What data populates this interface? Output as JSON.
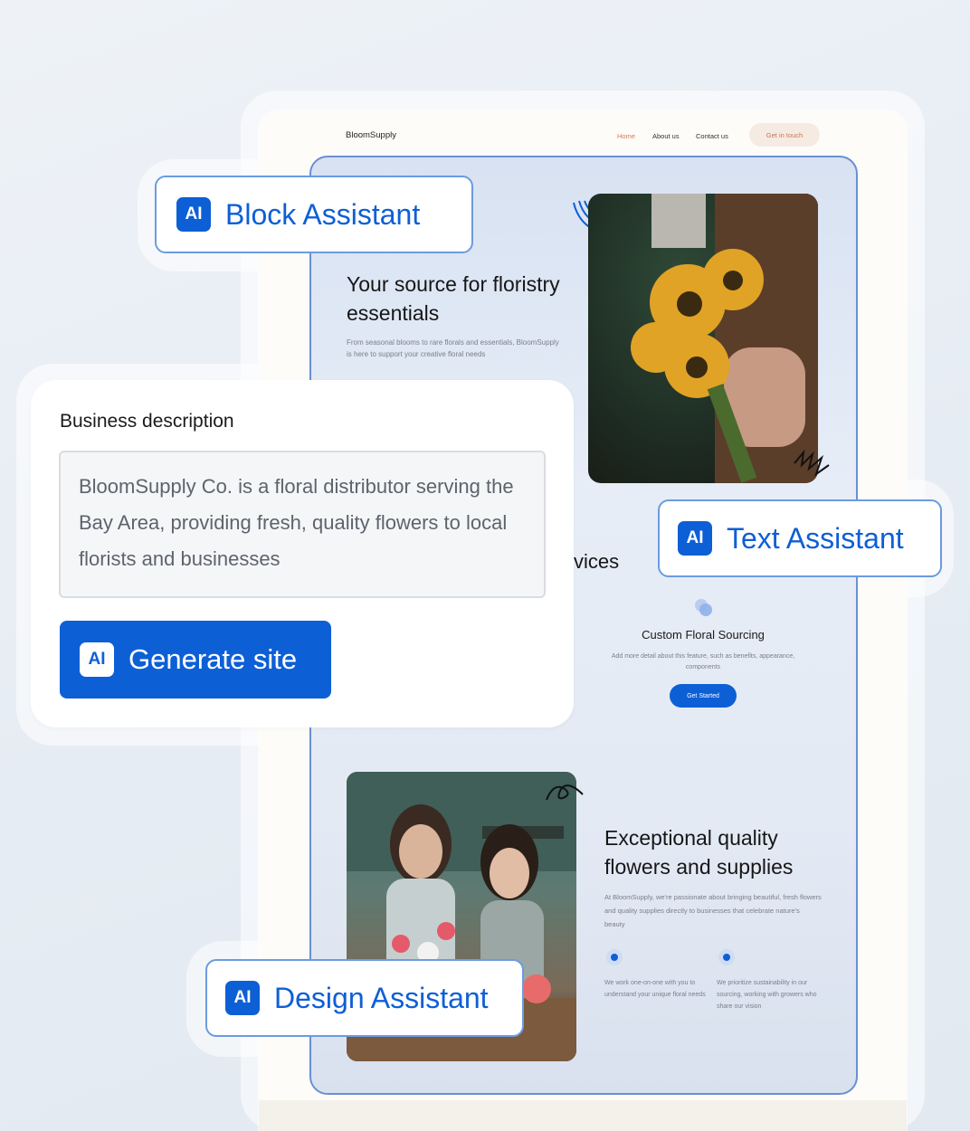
{
  "site": {
    "brand": "BloomSupply",
    "nav": [
      "Home",
      "About us",
      "Contact us"
    ],
    "cta": "Get in touch",
    "hero": {
      "title": "Your source for floristry essentials",
      "subtitle": "From seasonal blooms to rare florals and essentials, BloomSupply is here to support your creative floral needs"
    },
    "services_heading_partial": "vices",
    "feature": {
      "title": "Custom Floral Sourcing",
      "description": "Add more detail about this feature, such as benefits, appearance, components",
      "button": "Get Started"
    },
    "quality": {
      "title": "Exceptional quality flowers and supplies",
      "description": "At BloomSupply, we're passionate about bringing beautiful, fresh flowers and quality supplies directly to businesses that celebrate nature's beauty",
      "columns": [
        "We work one-on-one with you to understand your unique floral needs",
        "We prioritize sustainability in our sourcing, working with growers who share our vision"
      ]
    }
  },
  "chips": {
    "ai_badge": "AI",
    "block": "Block Assistant",
    "text": "Text Assistant",
    "design": "Design Assistant"
  },
  "panel": {
    "label": "Business description",
    "description_value": "BloomSupply Co. is a floral distributor serving the Bay Area, providing fresh, quality flowers to local florists and businesses",
    "generate_label": "Generate site"
  },
  "colors": {
    "primary": "#0d5fd6",
    "accent": "#d77a4a",
    "frame": "#6b8fd1"
  }
}
